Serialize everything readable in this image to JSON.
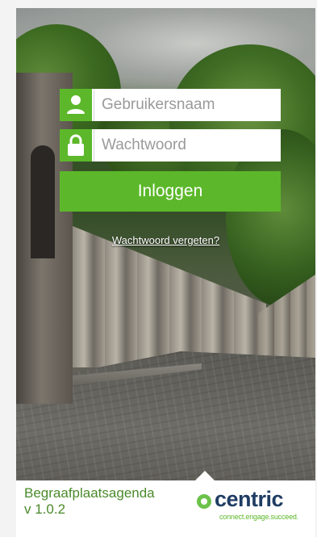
{
  "login": {
    "username_placeholder": "Gebruikersnaam",
    "password_placeholder": "Wachtwoord",
    "login_button": "Inloggen",
    "forgot_password": "Wachtwoord vergeten?"
  },
  "footer": {
    "app_name": "Begraafplaatsagenda",
    "version": "v 1.0.2",
    "logo_text": "centric",
    "logo_tagline": "connect.engage.succeed."
  },
  "icons": {
    "username": "person-icon",
    "password": "lock-icon"
  },
  "colors": {
    "accent": "#5cb82a",
    "brand_dark": "#1f3c63",
    "app_name": "#4a8a2a"
  }
}
